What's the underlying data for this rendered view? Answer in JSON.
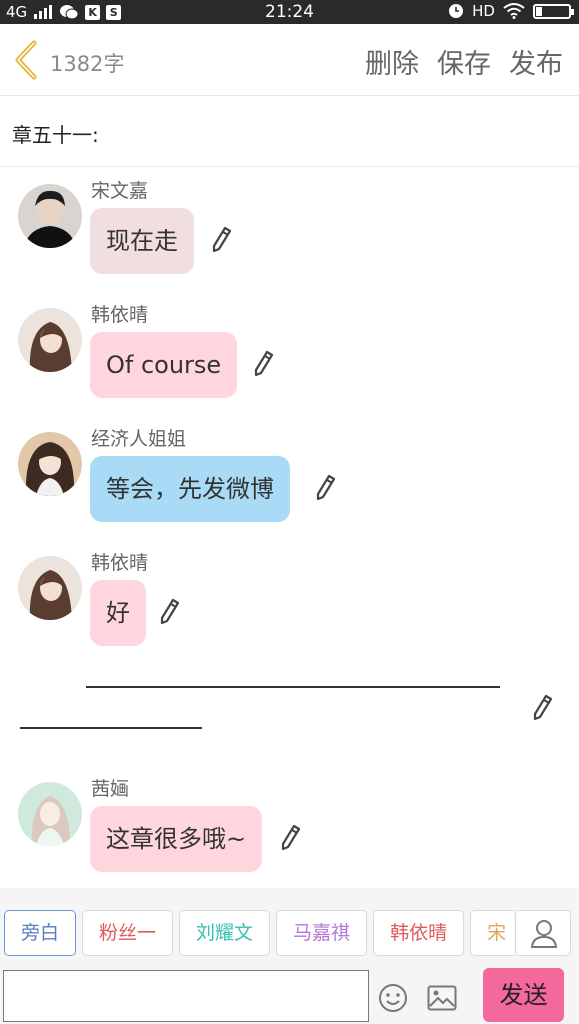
{
  "status_bar": {
    "network": "4G",
    "time": "21:24",
    "hd_label": "HD",
    "app_icons": [
      "wechat-icon",
      "k-app-icon",
      "s-app-icon"
    ]
  },
  "header": {
    "word_count": "1382字",
    "delete_label": "删除",
    "save_label": "保存",
    "publish_label": "发布"
  },
  "chapter": {
    "title": "章五十一:"
  },
  "messages": [
    {
      "name": "宋文嘉",
      "text": "现在走",
      "bubble_color": "#f1dfdf",
      "avatar": "avatar-songwenjia"
    },
    {
      "name": "韩依晴",
      "text": "Of course",
      "bubble_color": "#ffd6dd",
      "avatar": "avatar-hanyiqing"
    },
    {
      "name": "经济人姐姐",
      "text": "等会，先发微博",
      "bubble_color": "#a9dbf6",
      "avatar": "avatar-agent-sister"
    },
    {
      "name": "韩依晴",
      "text": "好",
      "bubble_color": "#ffd6dd",
      "avatar": "avatar-hanyiqing"
    },
    {
      "name": "茜婳",
      "text": "这章很多哦~",
      "bubble_color": "#ffd6dd",
      "avatar": "avatar-qianhua"
    }
  ],
  "characters": [
    {
      "label": "旁白",
      "color": "#5a7cc4"
    },
    {
      "label": "粉丝一",
      "color": "#e05b5b"
    },
    {
      "label": "刘耀文",
      "color": "#3bbfae"
    },
    {
      "label": "马嘉祺",
      "color": "#b476d8"
    },
    {
      "label": "韩依晴",
      "color": "#e05b5b"
    },
    {
      "label": "宋",
      "color": "#e0a75b"
    }
  ],
  "composer": {
    "input_value": "",
    "send_label": "发送"
  },
  "colors": {
    "accent": "#f4689c",
    "back_arrow": "#e8b53a"
  }
}
